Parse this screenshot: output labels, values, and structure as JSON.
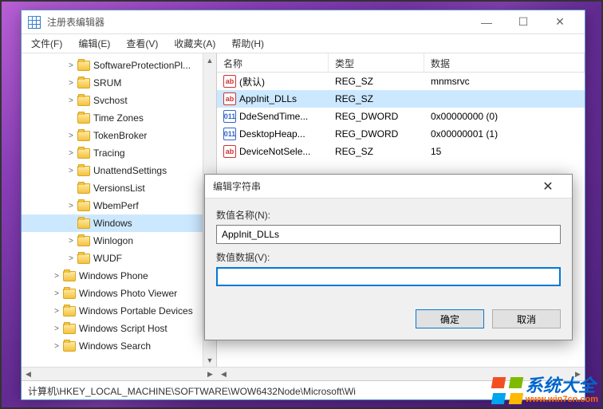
{
  "window": {
    "title": "注册表编辑器",
    "menus": [
      "文件(F)",
      "编辑(E)",
      "查看(V)",
      "收藏夹(A)",
      "帮助(H)"
    ],
    "statusbar": "计算机\\HKEY_LOCAL_MACHINE\\SOFTWARE\\WOW6432Node\\Microsoft\\Wi"
  },
  "tree": [
    {
      "depth": 2,
      "exp": ">",
      "label": "SoftwareProtectionPl..."
    },
    {
      "depth": 2,
      "exp": ">",
      "label": "SRUM"
    },
    {
      "depth": 2,
      "exp": ">",
      "label": "Svchost"
    },
    {
      "depth": 2,
      "exp": "",
      "label": "Time Zones"
    },
    {
      "depth": 2,
      "exp": ">",
      "label": "TokenBroker"
    },
    {
      "depth": 2,
      "exp": ">",
      "label": "Tracing"
    },
    {
      "depth": 2,
      "exp": ">",
      "label": "UnattendSettings"
    },
    {
      "depth": 2,
      "exp": "",
      "label": "VersionsList"
    },
    {
      "depth": 2,
      "exp": ">",
      "label": "WbemPerf"
    },
    {
      "depth": 2,
      "exp": "",
      "label": "Windows",
      "selected": true
    },
    {
      "depth": 2,
      "exp": ">",
      "label": "Winlogon"
    },
    {
      "depth": 2,
      "exp": ">",
      "label": "WUDF"
    },
    {
      "depth": 1,
      "exp": ">",
      "label": "Windows Phone"
    },
    {
      "depth": 1,
      "exp": ">",
      "label": "Windows Photo Viewer"
    },
    {
      "depth": 1,
      "exp": ">",
      "label": "Windows Portable Devices"
    },
    {
      "depth": 1,
      "exp": ">",
      "label": "Windows Script Host"
    },
    {
      "depth": 1,
      "exp": ">",
      "label": "Windows Search"
    }
  ],
  "list": {
    "headers": {
      "name": "名称",
      "type": "类型",
      "data": "数据"
    },
    "rows": [
      {
        "icon": "sz",
        "name": "(默认)",
        "type": "REG_SZ",
        "data": "mnmsrvc"
      },
      {
        "icon": "sz",
        "name": "AppInit_DLLs",
        "type": "REG_SZ",
        "data": "",
        "selected": true
      },
      {
        "icon": "dw",
        "name": "DdeSendTime...",
        "type": "REG_DWORD",
        "data": "0x00000000 (0)"
      },
      {
        "icon": "dw",
        "name": "DesktopHeap...",
        "type": "REG_DWORD",
        "data": "0x00000001 (1)"
      },
      {
        "icon": "sz",
        "name": "DeviceNotSele...",
        "type": "REG_SZ",
        "data": "15"
      }
    ]
  },
  "dialog": {
    "title": "编辑字符串",
    "name_label": "数值名称(N):",
    "name_value": "AppInit_DLLs",
    "data_label": "数值数据(V):",
    "data_value": "",
    "ok": "确定",
    "cancel": "取消"
  },
  "watermark": {
    "text": "系统大全",
    "url": "www.win7cn.com"
  }
}
